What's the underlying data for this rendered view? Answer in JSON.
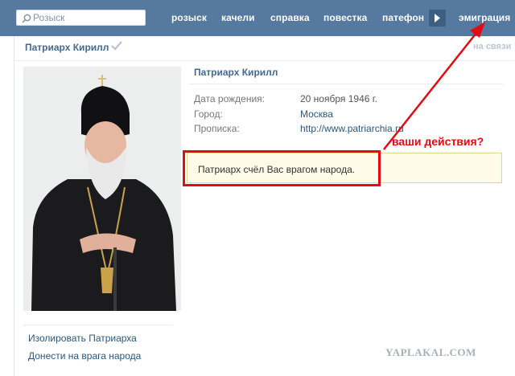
{
  "search": {
    "placeholder": "Розыск"
  },
  "nav": [
    {
      "label": "розыск"
    },
    {
      "label": "качели"
    },
    {
      "label": "справка"
    },
    {
      "label": "повестка"
    },
    {
      "label": "патефон"
    },
    {
      "label": "эмиграция"
    }
  ],
  "page": {
    "header_name": "Патриарх Кирилл",
    "online": "на связи"
  },
  "profile": {
    "name": "Патриарх Кирилл",
    "fields": [
      {
        "label": "Дата рождения:",
        "value": "20 ноября 1946 г."
      },
      {
        "label": "Город:",
        "value": "Москва"
      },
      {
        "label": "Прописка:",
        "value": "http://www.patriarchia.ru"
      }
    ],
    "notice": "Патриарх счёл Вас врагом народа."
  },
  "sidebar": {
    "links": [
      {
        "label": "Изолировать Патриарха"
      },
      {
        "label": "Донести на врага народа"
      }
    ]
  },
  "annotation": "ваши действия?",
  "watermark": "YAPLAKAL.COM",
  "colors": {
    "topbar": "#55799f",
    "link": "#2b587a",
    "annotation_red": "#e30b14",
    "notice_bg": "#fefbe9"
  }
}
